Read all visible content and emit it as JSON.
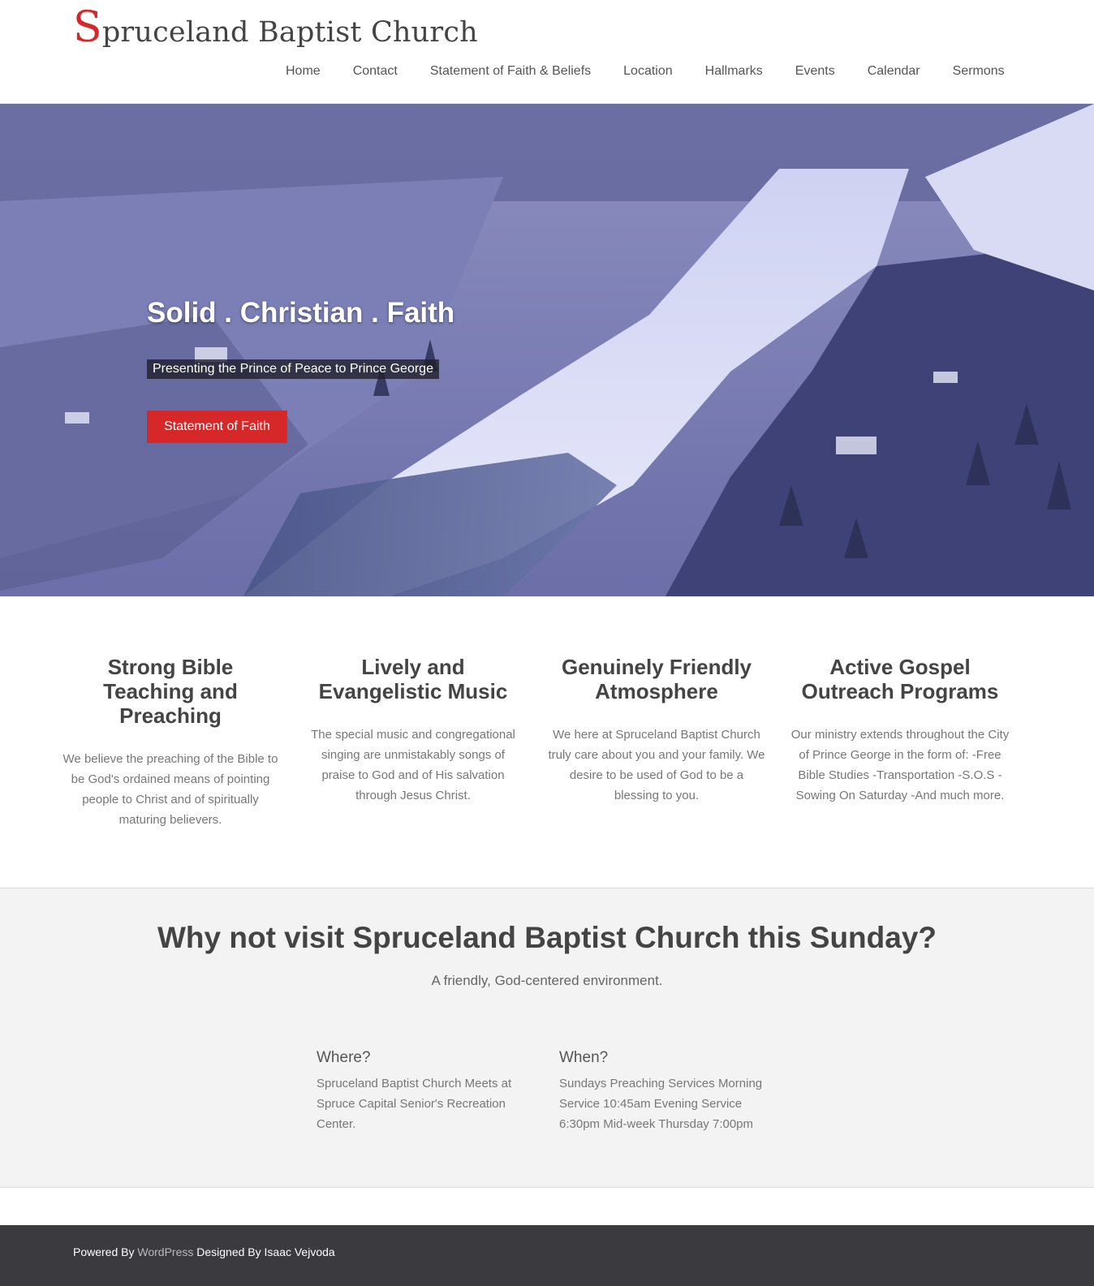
{
  "site": {
    "logo_initial": "S",
    "logo_rest": "pruceland Baptist Church"
  },
  "nav": [
    "Home",
    "Contact",
    "Statement of Faith & Beliefs",
    "Location",
    "Hallmarks",
    "Events",
    "Calendar",
    "Sermons"
  ],
  "hero": {
    "title": "Solid . Christian . Faith",
    "subtitle": "Presenting the Prince of Peace to Prince George",
    "button": "Statement of Faith"
  },
  "features": [
    {
      "title": "Strong Bible Teaching and Preaching",
      "text": "We believe the preaching of the Bible to be God's ordained means of pointing people to Christ and of spiritually maturing believers."
    },
    {
      "title": "Lively and Evangelistic Music",
      "text": "The special music and congregational singing are unmistakably songs of praise to God and of His salvation through Jesus Christ."
    },
    {
      "title": "Genuinely Friendly Atmosphere",
      "text": "We here at Spruceland Baptist Church truly care about you and your family. We desire to be used of God to be a blessing to you."
    },
    {
      "title": "Active Gospel Outreach Programs",
      "text": "Our ministry extends throughout the City of Prince George in the form of: -Free Bible Studies -Transportation -S.O.S - Sowing On Saturday -And much more."
    }
  ],
  "visit": {
    "heading": "Why not visit Spruceland Baptist Church this Sunday?",
    "tagline": "A friendly, God-centered environment.",
    "where_title": "Where?",
    "where_text": "Spruceland Baptist Church Meets at Spruce Capital Senior's Recreation Center.",
    "when_title": "When?",
    "when_text": "Sundays Preaching Services Morning Service 10:45am Evening Service 6:30pm Mid-week Thursday 7:00pm"
  },
  "footer": {
    "powered": "Powered By",
    "wordpress": "WordPress",
    "designed": "Designed By Isaac Vejvoda"
  },
  "colors": {
    "accent": "#d62828",
    "footer_bg": "#3a3a3f",
    "section_bg": "#f4f3f3"
  }
}
